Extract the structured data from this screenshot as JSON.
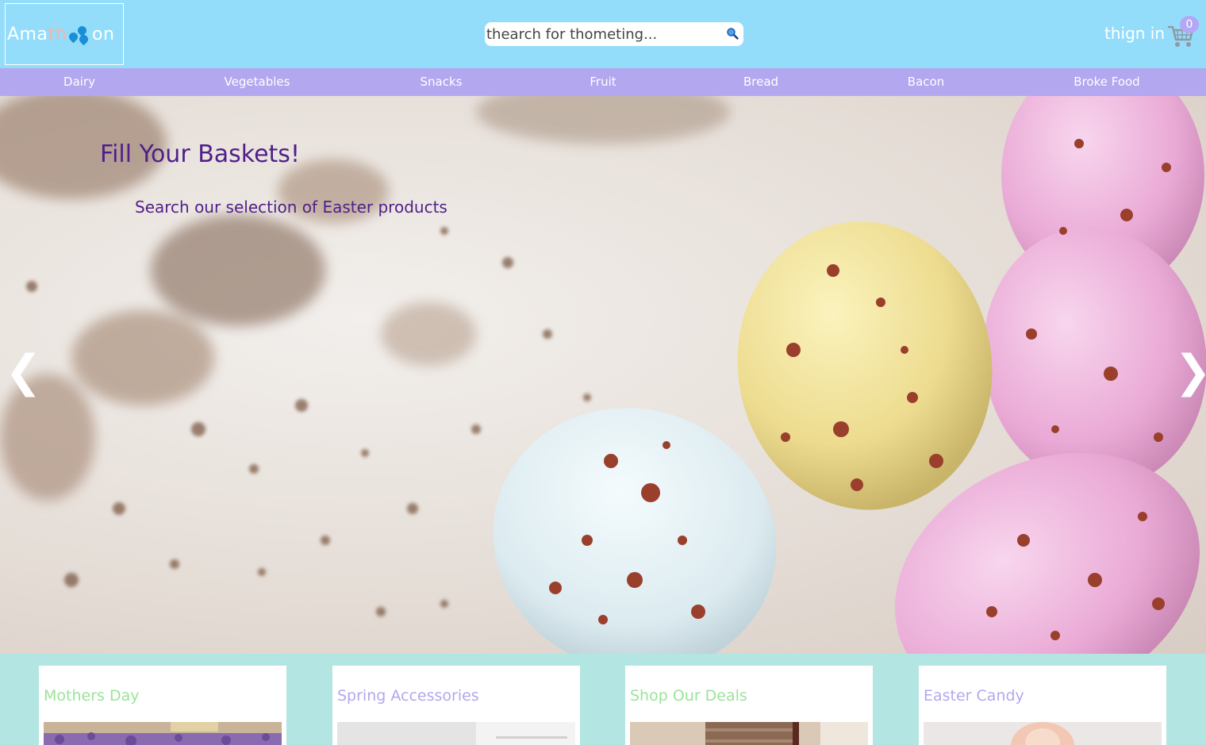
{
  "header": {
    "logo": {
      "part1": "Ama",
      "part2": "th",
      "part3": "on"
    },
    "search": {
      "placeholder": "thearch for thometing..."
    },
    "signin_label": "thign in",
    "cart_count": "0"
  },
  "nav": {
    "items": [
      "Dairy",
      "Vegetables",
      "Snacks",
      "Fruit",
      "Bread",
      "Bacon",
      "Broke Food"
    ]
  },
  "hero": {
    "title": "Fill Your Baskets!",
    "subtitle": "Search our selection of Easter products",
    "prev": "❮",
    "next": "❯"
  },
  "cards": [
    {
      "title": "Mothers Day",
      "color": "#9be39a"
    },
    {
      "title": "Spring Accessories",
      "color": "#b3a7ef"
    },
    {
      "title": "Shop Our Deals",
      "color": "#9be39a"
    },
    {
      "title": "Easter Candy",
      "color": "#b3a7ef"
    }
  ],
  "colors": {
    "header_bg": "#93ddfb",
    "nav_bg": "#b3a7ef",
    "hero_text": "#4f1f8a",
    "page_bg": "#b3e6e2"
  }
}
